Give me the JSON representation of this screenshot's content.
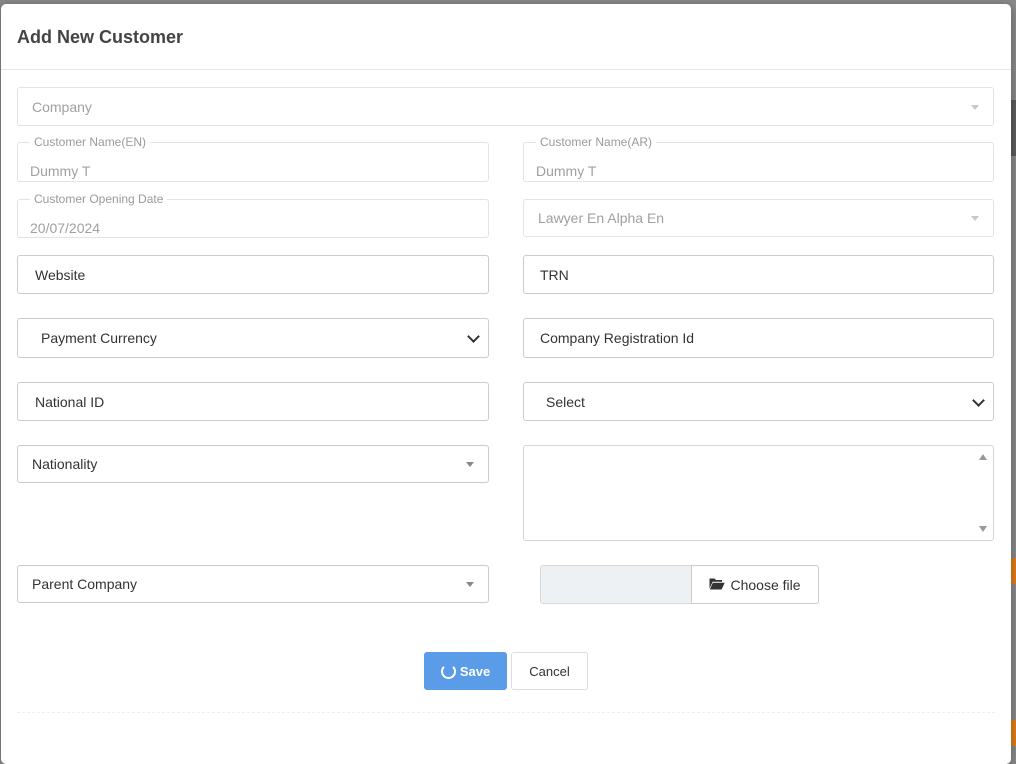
{
  "modal": {
    "title": "Add New Customer"
  },
  "form": {
    "company": {
      "placeholder": "Company"
    },
    "customer_name_en": {
      "label": "Customer Name(EN)",
      "value": "Dummy T"
    },
    "customer_name_ar": {
      "label": "Customer Name(AR)",
      "value": "Dummy T"
    },
    "customer_opening_date": {
      "label": "Customer Opening Date",
      "value": "20/07/2024"
    },
    "lawyer": {
      "value": "Lawyer En Alpha En"
    },
    "website": {
      "placeholder": "Website"
    },
    "trn": {
      "placeholder": "TRN"
    },
    "payment_currency": {
      "value": "Payment Currency"
    },
    "company_registration_id": {
      "placeholder": "Company Registration Id"
    },
    "national_id": {
      "placeholder": "National ID"
    },
    "select": {
      "value": "Select"
    },
    "nationality": {
      "placeholder": "Nationality"
    },
    "notes": {
      "value": ""
    },
    "parent_company": {
      "placeholder": "Parent Company"
    },
    "file": {
      "button_label": "Choose file",
      "icon": "folder-open-icon"
    }
  },
  "actions": {
    "save_label": "Save",
    "save_icon": "spinner-icon",
    "cancel_label": "Cancel"
  },
  "colors": {
    "primary": "#5b9ce8",
    "backdrop": "#8a8a8a",
    "accent_orange": "#e07c1a"
  }
}
